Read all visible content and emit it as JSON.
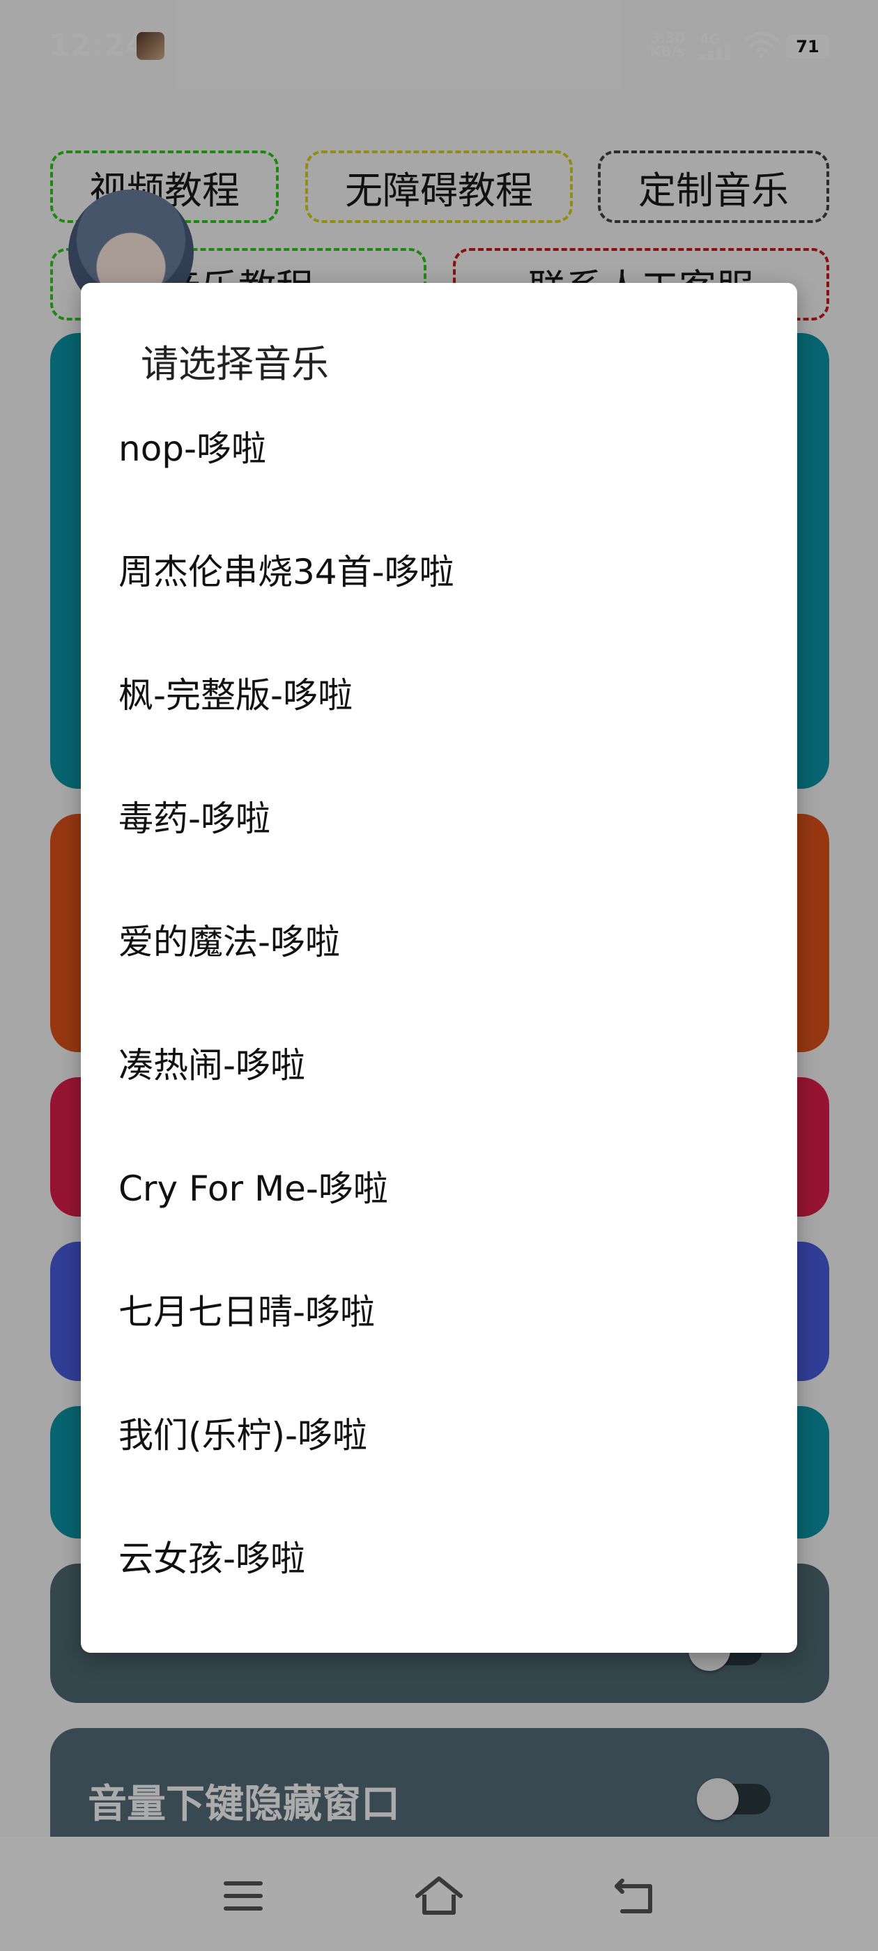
{
  "status_bar": {
    "time": "12:24",
    "net_speed_value": "3.30",
    "net_speed_unit": "KB/s",
    "network_type": "4G",
    "battery": "71"
  },
  "chips": [
    {
      "label": "视频教程",
      "border_color": "#2ecc1a"
    },
    {
      "label": "无障碍教程",
      "border_color": "#d8d21a"
    },
    {
      "label": "定制音乐",
      "border_color": "#444444"
    },
    {
      "label": "音乐教程",
      "border_color": "#2ecc1a"
    },
    {
      "label": "联系人工客服",
      "border_color": "#cc1a1a"
    }
  ],
  "cards": {
    "colors": [
      "#0b95a8",
      "#e2531c",
      "#e01e4a",
      "#4a5de0",
      "#0b95a8",
      "#4e6a73",
      "#546e7a"
    ],
    "volume_hide_label": "音量下键隐藏窗口"
  },
  "dialog": {
    "title": "请选择音乐",
    "options": [
      "nop-哆啦",
      "周杰伦串烧34首-哆啦",
      "枫-完整版-哆啦",
      "毒药-哆啦",
      "爱的魔法-哆啦",
      "凑热闹-哆啦",
      "Cry For Me-哆啦",
      "七月七日晴-哆啦",
      "我们(乐柠)-哆啦",
      "云女孩-哆啦"
    ]
  },
  "nav_bar": {
    "icons": [
      "menu-icon",
      "home-icon",
      "back-icon"
    ]
  }
}
